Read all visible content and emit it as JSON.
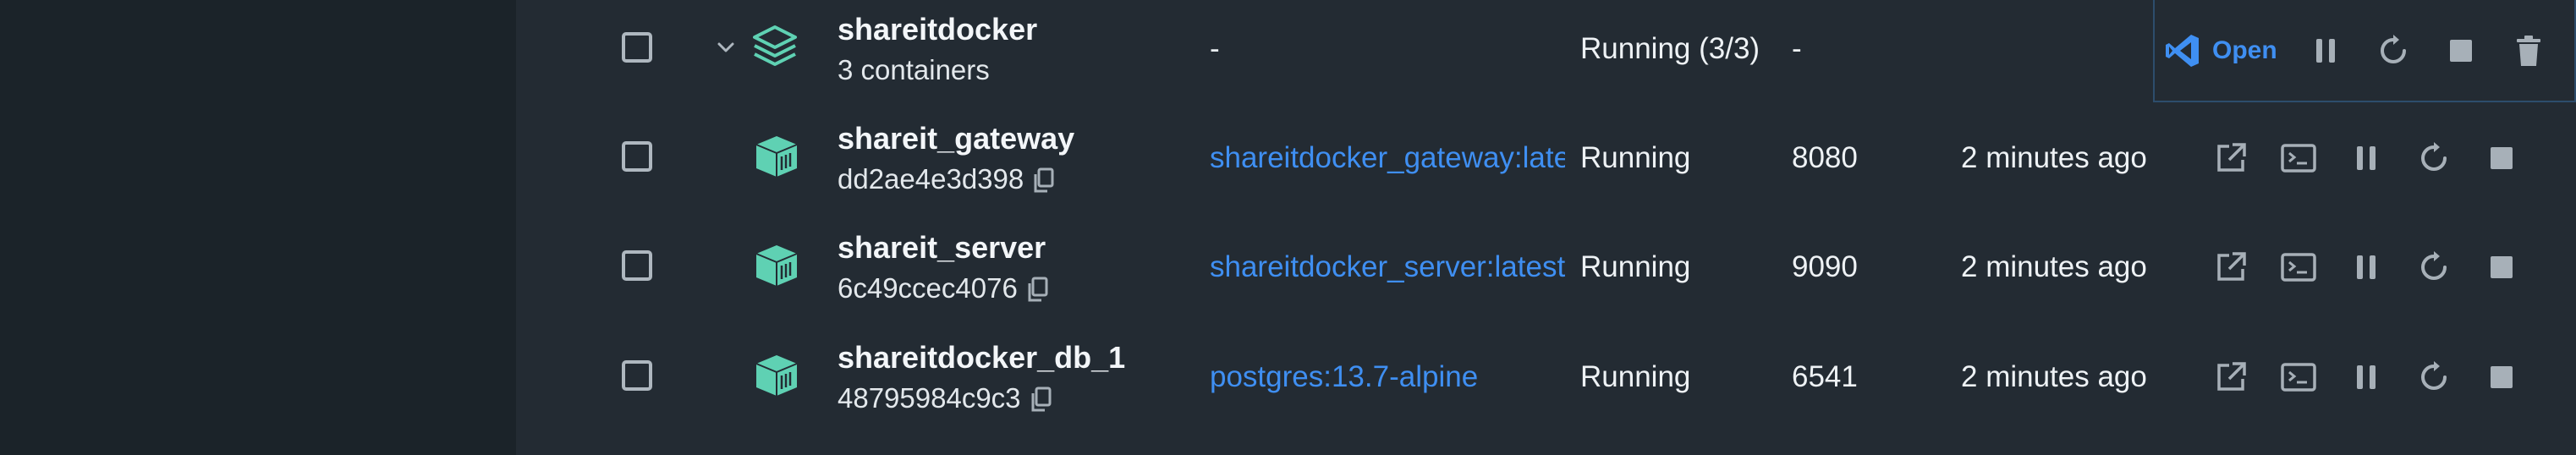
{
  "colors": {
    "accent": "#3f8ff2",
    "container_icon": "#5fd1b3",
    "icon_gray": "#a7b0b8"
  },
  "project": {
    "name": "shareitdocker",
    "subtitle": "3 containers",
    "image": "-",
    "status": "Running (3/3)",
    "port": "-",
    "started": "",
    "open_label": "Open"
  },
  "containers": [
    {
      "name": "shareit_gateway",
      "id": "dd2ae4e3d398",
      "image": "shareitdocker_gateway:latest",
      "status": "Running",
      "port": "8080",
      "started": "2 minutes ago"
    },
    {
      "name": "shareit_server",
      "id": "6c49ccec4076",
      "image": "shareitdocker_server:latest",
      "status": "Running",
      "port": "9090",
      "started": "2 minutes ago"
    },
    {
      "name": "shareitdocker_db_1",
      "id": "48795984c9c3",
      "image": "postgres:13.7-alpine",
      "status": "Running",
      "port": "6541",
      "started": "2 minutes ago"
    }
  ]
}
